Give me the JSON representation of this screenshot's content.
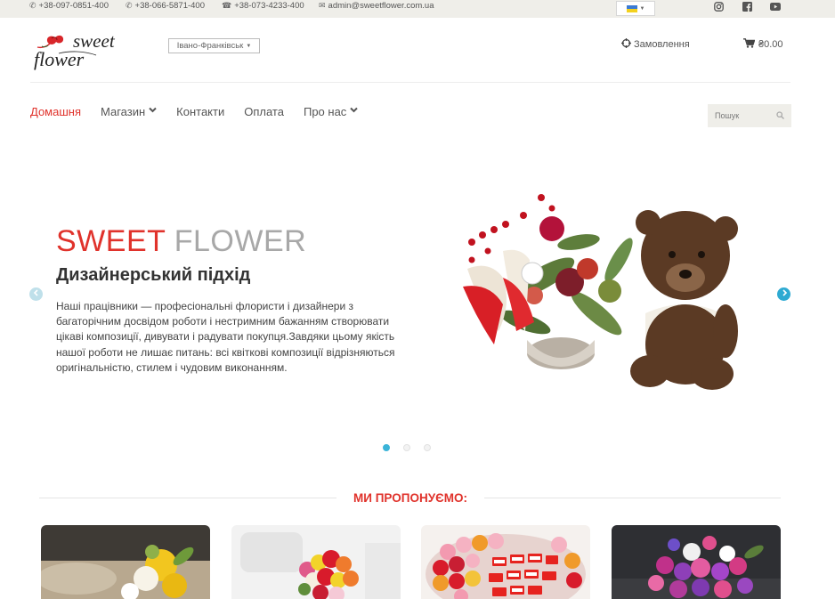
{
  "topbar": {
    "phone1": "+38-097-0851-400",
    "phone2": "+38-066-5871-400",
    "phone3": "+38-073-4233-400",
    "email": "admin@sweetflower.com.ua",
    "language_flag": "ua-flag",
    "social": [
      "instagram-icon",
      "facebook-icon",
      "youtube-icon"
    ]
  },
  "header": {
    "logo_word1": "sweet",
    "logo_word2": "flower",
    "city": "Івано-Франківськ",
    "orders": "Замовлення",
    "cart_total": "₴0.00"
  },
  "nav": {
    "items": [
      {
        "label": "Домашня",
        "active": true
      },
      {
        "label": "Магазин",
        "dropdown": true
      },
      {
        "label": "Контакти"
      },
      {
        "label": "Оплата"
      },
      {
        "label": "Про нас",
        "dropdown": true
      }
    ],
    "search_placeholder": "Пошук"
  },
  "hero": {
    "title_red": "SWEET",
    "title_gray": "FLOWER",
    "subtitle": "Дизайнерський підхід",
    "text": "Наші працівники — професіональні флористи і дизайнери з багаторічним досвідом роботи і нестримним бажанням створювати цікаві композиції, дивувати і радувати покупця.Завдяки цьому якість нашої роботи не лишає питань: всі квіткові композиції відрізняються оригінальністю, стилем і чудовим виконанням.",
    "slides_count": 3,
    "active_slide": 1
  },
  "offers": {
    "title": "МИ ПРОПОНУЄМО:"
  },
  "colors": {
    "accent": "#e0322b",
    "topbar_bg": "#efeee9",
    "slider_dot": "#3bb4d8"
  }
}
